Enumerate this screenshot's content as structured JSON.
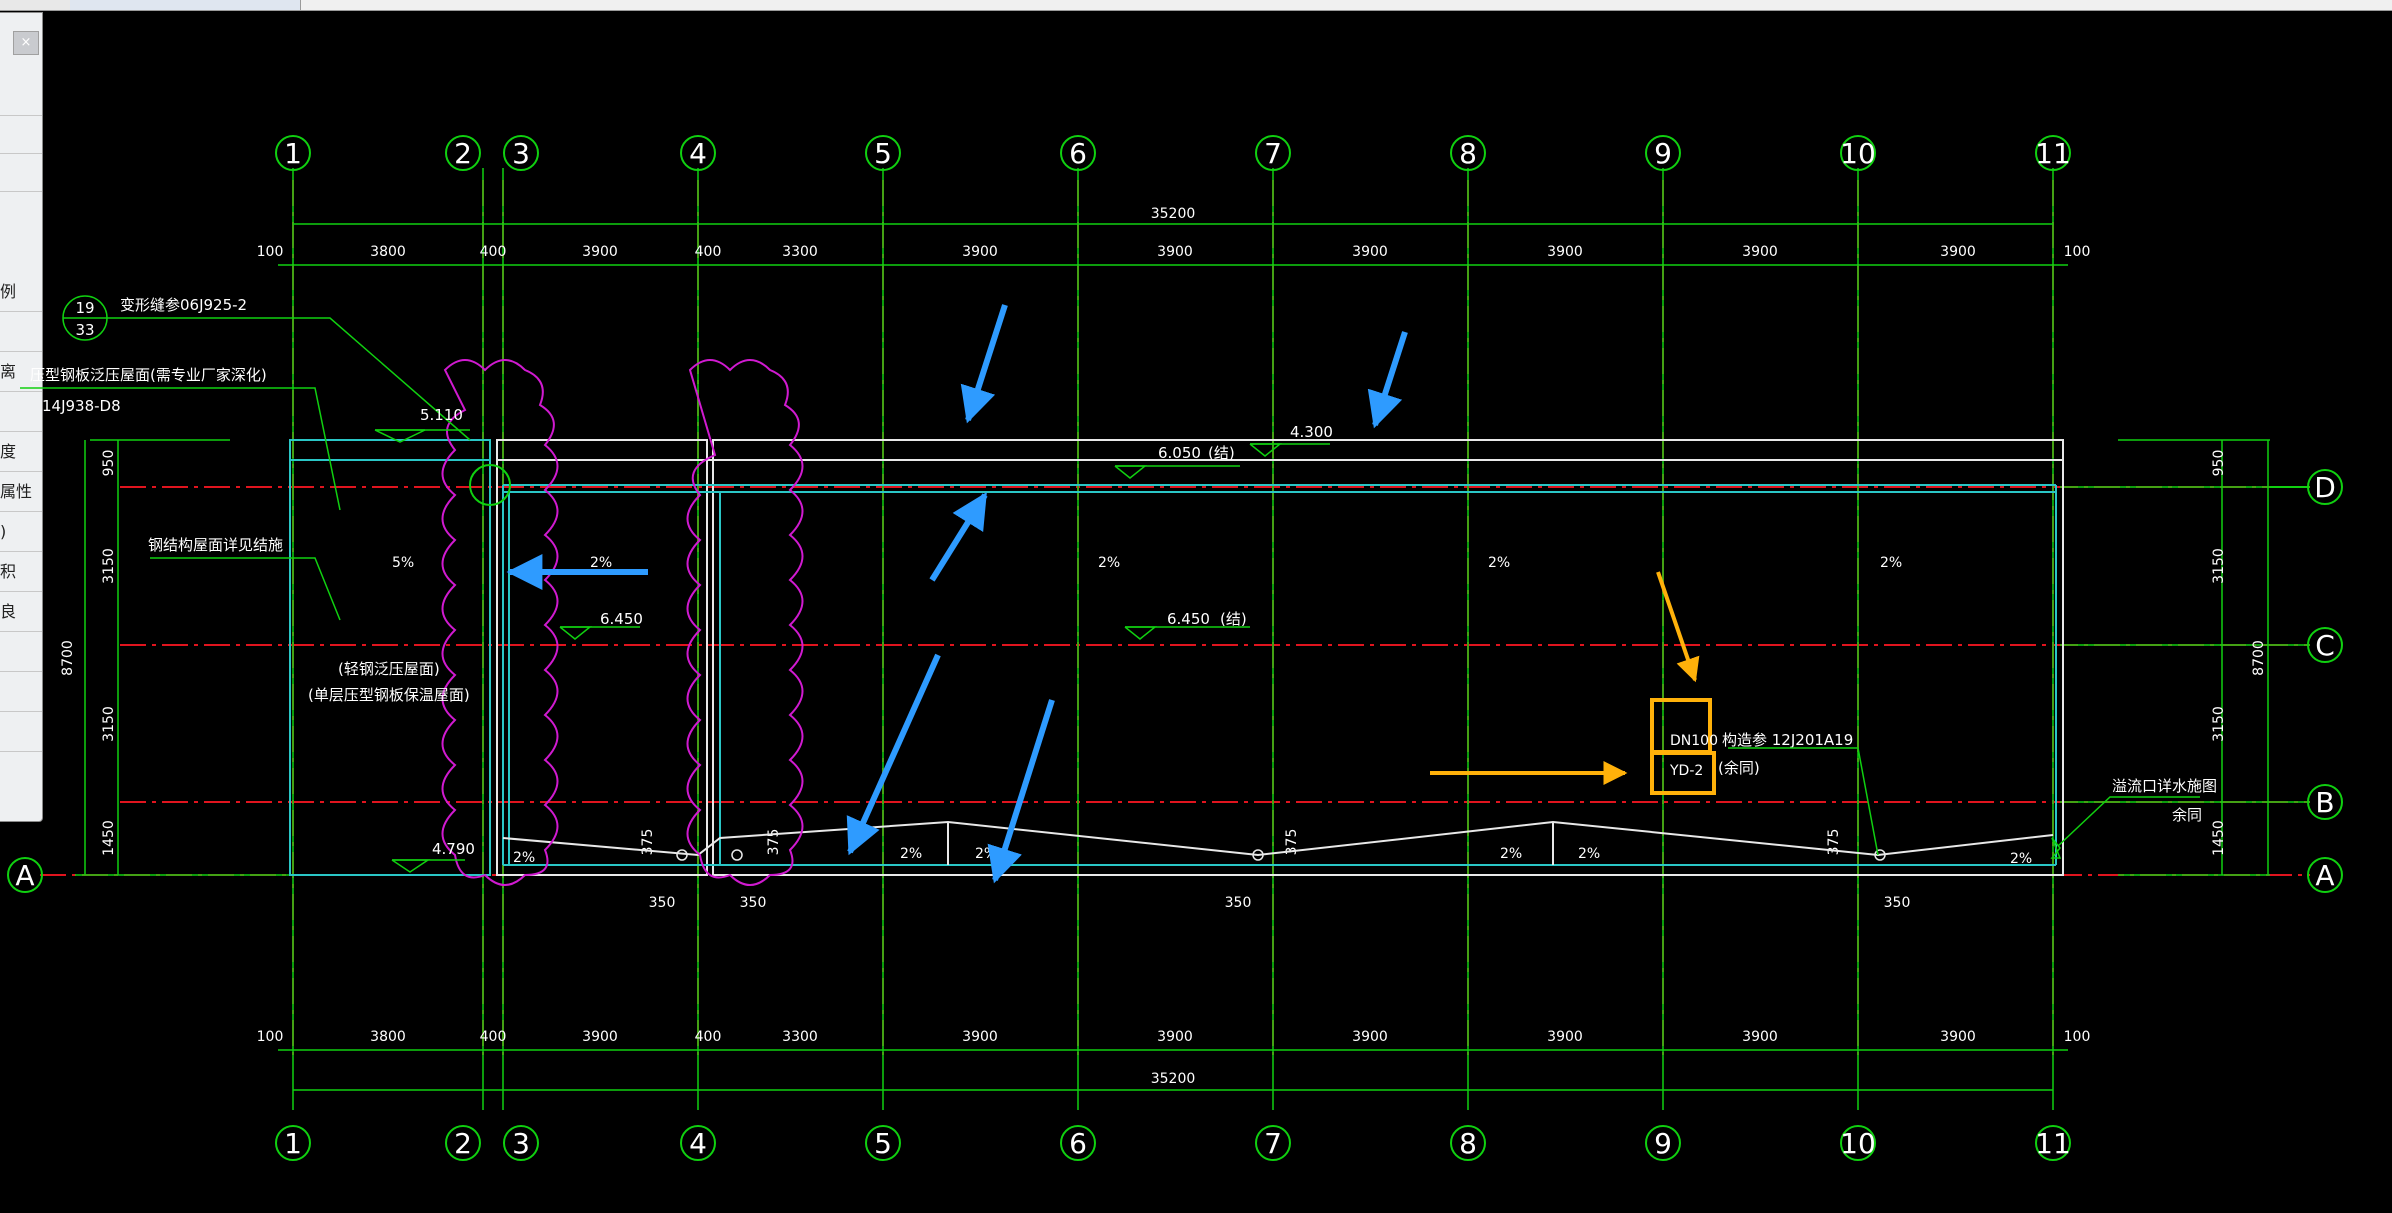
{
  "panel": {
    "close_label": "×",
    "rows": [
      "",
      "",
      "",
      "例",
      "",
      "离",
      "",
      "度",
      "属性",
      ")",
      "积",
      "良",
      "",
      "",
      ""
    ]
  },
  "axes_top": [
    "1",
    "2",
    "3",
    "4",
    "5",
    "6",
    "7",
    "8",
    "9",
    "10",
    "11"
  ],
  "axes_right": [
    "D",
    "C",
    "B",
    "A"
  ],
  "axis_left": "A",
  "dims": {
    "total": "35200",
    "edge": "100",
    "spans": [
      "3800",
      "400",
      "3900",
      "400",
      "3300",
      "3900",
      "3900",
      "3900",
      "3900",
      "3900",
      "3900"
    ],
    "h_right": [
      "950",
      "3150",
      "3150",
      "1450"
    ],
    "h_total": "8700",
    "drain_offset": "350",
    "drain_vert": "375"
  },
  "elev": {
    "e5110": "5.110",
    "e4300": "4.300",
    "e6050": "6.050",
    "e6050_suffix": "(结)",
    "e6450a": "6.450",
    "e6450b": "6.450",
    "e6450_suffix": "(结)",
    "e4790": "4.790"
  },
  "slopes": {
    "s5": "5%",
    "s2": "2%"
  },
  "notes": {
    "joint_circle_top": "19",
    "joint_circle_bottom": "33",
    "joint": "变形缝参06J925-2",
    "roof_type": "压型钢板泛压屋面(需专业厂家深化)",
    "roof_std": "14J938-D8",
    "steel_roof": "钢结构屋面详见结施",
    "sheet1": "(轻钢泛压屋面)",
    "sheet2": "(单层压型钢板保温屋面)",
    "dn100": "DN100",
    "yd2": "YD-2",
    "construct": "构造参 12J201A19",
    "same1": "(余同)",
    "overflow": "溢流口详水施图",
    "same2": "余同"
  }
}
